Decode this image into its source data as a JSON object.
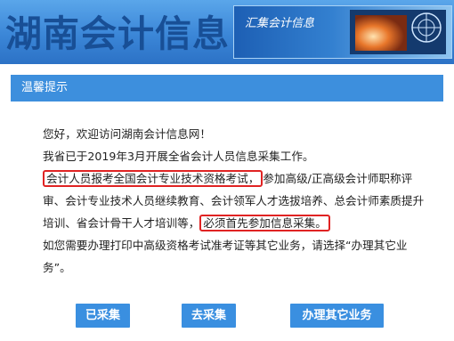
{
  "banner": {
    "site_title": "湖南会计信息",
    "panel_label": "汇集会计信息"
  },
  "notice": {
    "title": "温馨提示"
  },
  "content": {
    "greeting": "您好，欢迎访问湖南会计信息网！",
    "line2": "我省已于2019年3月开展全省会计人员信息采集工作。",
    "para3_part1": "会计人员报考全国会计专业技术资格考试，",
    "para3_part2": "参加高级/正高级会计师职称评审、会计专业技术人员继续教育、会计领军人才选拔培养、总会计师素质提升培训、省会计骨干人才培训等，",
    "para3_part3": "必须首先参加信息采集。",
    "para4": "如您需要办理打印中高级资格考试准考证等其它业务，请选择“办理其它业务”。"
  },
  "buttons": {
    "collected": "已采集",
    "go_collect": "去采集",
    "other_business": "办理其它业务"
  },
  "colors": {
    "banner_blue": "#3b86d7",
    "notice_bar": "#3d8fdd",
    "button_blue": "#3a8fe0",
    "highlight_red": "#e02323"
  }
}
